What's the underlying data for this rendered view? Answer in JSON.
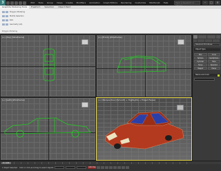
{
  "app": {
    "logo_letter": "3",
    "menu": [
      "Edit",
      "Tools",
      "Group",
      "Views",
      "Create",
      "Modifiers",
      "Animation",
      "Graph Editors",
      "Rendering",
      "Customize",
      "MAXScript",
      "Help"
    ],
    "search_placeholder": "Type a keyword or phrase",
    "window_controls": [
      "–",
      "□",
      "×"
    ]
  },
  "ribbon": {
    "tabs": [
      "Graphite Modeling Tools",
      "Freeform",
      "Selection",
      "Object Paint"
    ],
    "active_tab": 0,
    "rows": [
      "Polygon Modeling",
      "Modify Selection",
      "Edit",
      "Geometry (All)"
    ],
    "group_label": "Polygon Modeling"
  },
  "viewports": {
    "top": {
      "label": "[+] [Top] [Wireframe]"
    },
    "front": {
      "label": "[+] [Front] [Wireframe]"
    },
    "left": {
      "label": "[+] [Left] [Wireframe]"
    },
    "perspective": {
      "label": "[+] [Perspective] [Smooth + Highlights + Edged Faces]"
    }
  },
  "command_panel": {
    "category": "Standard Primitives",
    "object_type_header": "Object Type",
    "autogrid": "AutoGrid",
    "primitives": [
      "Box",
      "Cone",
      "Sphere",
      "GeoSphere",
      "Cylinder",
      "Tube",
      "Torus",
      "Pyramid",
      "Teapot",
      "Plane"
    ],
    "name_color_header": "Name and Color"
  },
  "timeline": {
    "slider": "0 / 100"
  },
  "status": {
    "selection": "1 Object Selected",
    "hint": "Click or click-and-drag to select objects",
    "autokey": "Auto Key"
  },
  "colors": {
    "wire_green": "#22cc22",
    "car_body": "#b33a1f",
    "active_border": "#e8d84a"
  }
}
